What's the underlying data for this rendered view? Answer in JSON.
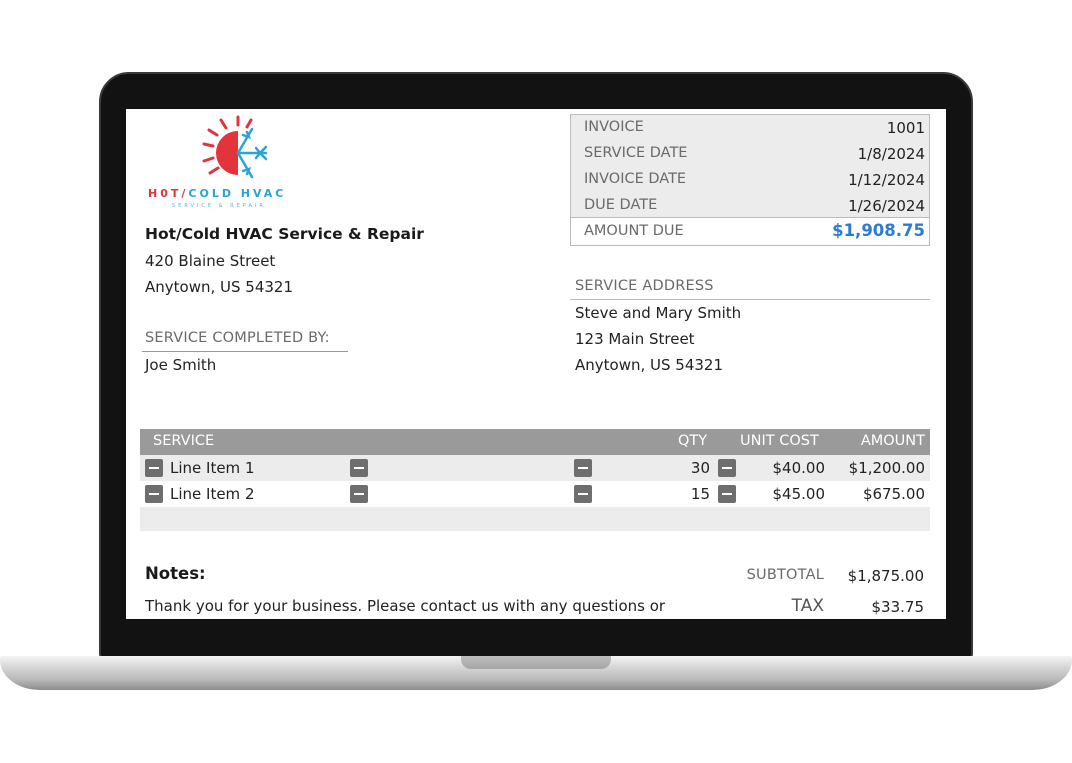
{
  "brand": {
    "logo_name": "HOT/COLD HVAC",
    "logo_hot": "H0T/",
    "logo_cold": "COLD HVAC",
    "logo_tagline": "SERVICE & REPAIR",
    "colors": {
      "hot": "#e2343a",
      "cold": "#2aa3d8",
      "amount_due": "#2a7bd1"
    }
  },
  "company": {
    "name": "Hot/Cold HVAC Service & Repair",
    "address_line1": "420 Blaine Street",
    "address_line2": "Anytown, US 54321"
  },
  "service_completed_by": {
    "label": "SERVICE COMPLETED BY:",
    "name": "Joe Smith"
  },
  "invoice_info": {
    "invoice_label": "INVOICE",
    "invoice_number": "1001",
    "service_date_label": "SERVICE DATE",
    "service_date": "1/8/2024",
    "invoice_date_label": "INVOICE DATE",
    "invoice_date": "1/12/2024",
    "due_date_label": "DUE DATE",
    "due_date": "1/26/2024",
    "amount_due_label": "AMOUNT DUE",
    "amount_due": "$1,908.75"
  },
  "service_address": {
    "label": "SERVICE ADDRESS",
    "name": "Steve and Mary Smith",
    "line1": "123 Main Street",
    "line2": "Anytown, US 54321"
  },
  "line_items": {
    "headers": {
      "service": "SERVICE",
      "qty": "QTY",
      "unit_cost": "UNIT COST",
      "amount": "AMOUNT"
    },
    "rows": [
      {
        "service": "Line Item 1",
        "qty": "30",
        "unit_cost": "$40.00",
        "amount": "$1,200.00"
      },
      {
        "service": "Line Item 2",
        "qty": "15",
        "unit_cost": "$45.00",
        "amount": "$675.00"
      }
    ]
  },
  "notes": {
    "label": "Notes:",
    "text": "Thank you for your business. Please contact us with any questions or concerns."
  },
  "totals": {
    "subtotal_label": "SUBTOTAL",
    "subtotal": "$1,875.00",
    "tax_label": "TAX",
    "tax": "$33.75"
  }
}
